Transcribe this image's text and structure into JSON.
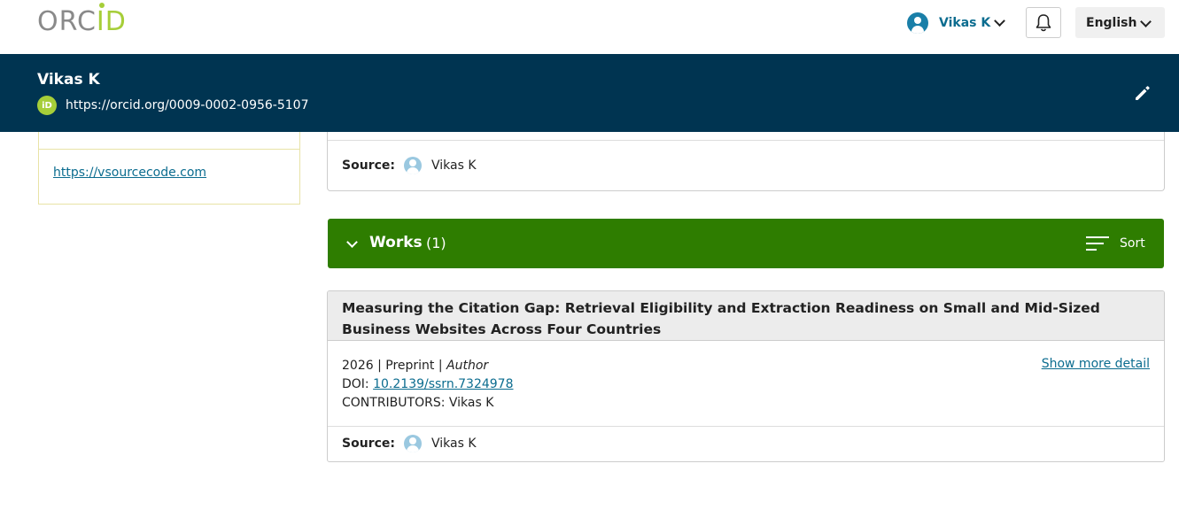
{
  "topbar": {
    "logo_text_a": "ORC",
    "logo_text_b": "ID",
    "user_name": "Vikas K",
    "language": "English"
  },
  "banner": {
    "name": "Vikas K",
    "orcid_badge": "iD",
    "orcid_url": "https://orcid.org/0009-0002-0956-5107"
  },
  "sidebar": {
    "website_link": "https://vsourcecode.com"
  },
  "prev_card": {
    "source_label": "Source:",
    "source_name": "Vikas K"
  },
  "works": {
    "title": "Works",
    "count": "(1)",
    "sort_label": "Sort",
    "items": [
      {
        "title": "Measuring the Citation Gap: Retrieval Eligibility and Extraction Readiness on Small and Mid-Sized Business Websites Across Four Countries",
        "year_type": "2026 | Preprint | ",
        "role": "Author",
        "doi_label": "DOI: ",
        "doi": "10.2139/ssrn.7324978",
        "contributors": "CONTRIBUTORS: Vikas K",
        "more_label": "Show more detail",
        "source_label": "Source:",
        "source_name": "Vikas K"
      }
    ]
  },
  "colors": {
    "banner": "#003451",
    "works_bar": "#2e7d00",
    "link": "#0b6c8f",
    "orcid_green": "#a6ce39"
  }
}
